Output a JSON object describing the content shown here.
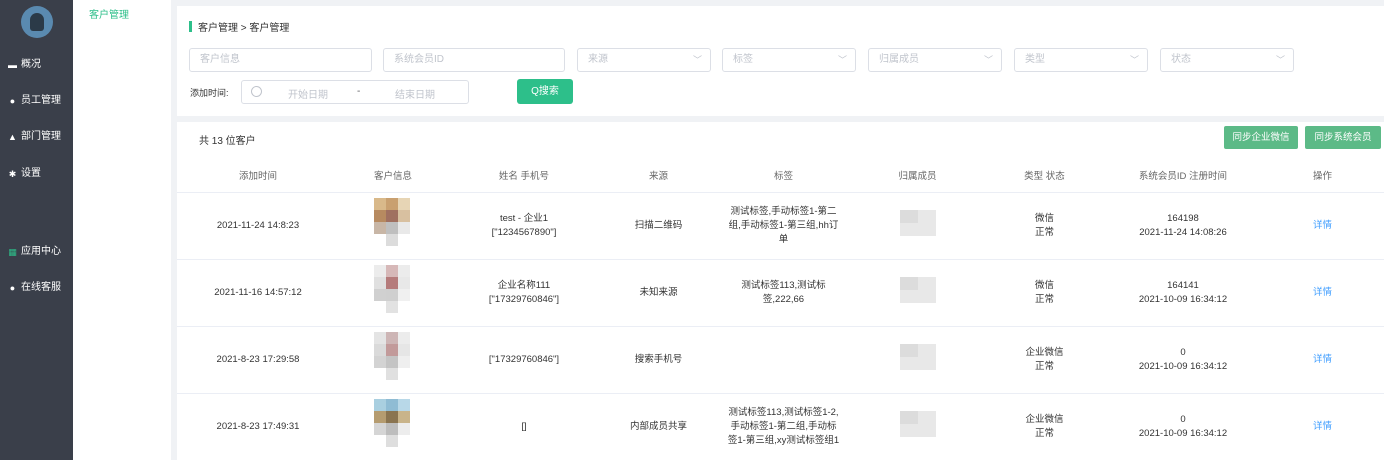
{
  "sidebar": {
    "items": [
      {
        "label": "概况",
        "icon": "overview-icon"
      },
      {
        "label": "员工管理",
        "icon": "staff-icon"
      },
      {
        "label": "部门管理",
        "icon": "department-icon"
      },
      {
        "label": "设置",
        "icon": "gear-icon"
      },
      {
        "label": "应用中心",
        "icon": "grid-icon"
      },
      {
        "label": "在线客服",
        "icon": "support-icon"
      }
    ]
  },
  "submenu": {
    "active": "客户管理"
  },
  "breadcrumb": "客户管理 > 客户管理",
  "filters": {
    "customer_info": "客户信息",
    "member_id": "系统会员ID",
    "source": "来源",
    "tag": "标签",
    "owner": "归属成员",
    "type": "类型",
    "status": "状态",
    "date_label": "添加时间:",
    "date_start": "开始日期",
    "date_sep": "-",
    "date_end": "结束日期",
    "search_label": "Q搜索"
  },
  "table_header": {
    "count": "共 13 位客户",
    "sync_wechat": "同步企业微信",
    "sync_members": "同步系统会员"
  },
  "columns": [
    "添加时间",
    "客户信息",
    "姓名 手机号",
    "来源",
    "标签",
    "归属成员",
    "类型 状态",
    "系统会员ID 注册时间",
    "操作"
  ],
  "rows": [
    {
      "added": "2021-11-24 14:8:23",
      "name": "test - 企业1",
      "phone": "[\"1234567890\"]",
      "source": "扫描二维码",
      "tags": "测试标签,手动标签1-第二组,手动标签1-第三组,hh订单",
      "type": "微信",
      "status": "正常",
      "member_id": "164198",
      "reg_time": "2021-11-24 14:08:26",
      "action": "详情"
    },
    {
      "added": "2021-11-16 14:57:12",
      "name": "企业名称111",
      "phone": "[\"17329760846\"]",
      "source": "未知来源",
      "tags": "测试标签113,测试标签,222,66",
      "type": "微信",
      "status": "正常",
      "member_id": "164141",
      "reg_time": "2021-10-09 16:34:12",
      "action": "详情"
    },
    {
      "added": "2021-8-23 17:29:58",
      "name": "",
      "phone": "[\"17329760846\"]",
      "source": "搜索手机号",
      "tags": "",
      "type": "企业微信",
      "status": "正常",
      "member_id": "0",
      "reg_time": "2021-10-09 16:34:12",
      "action": "详情"
    },
    {
      "added": "2021-8-23 17:49:31",
      "name": "",
      "phone": "[]",
      "source": "内部成员共享",
      "tags": "测试标签113,测试标签1-2,手动标签1-第二组,手动标签1-第三组,xy测试标签组1",
      "type": "企业微信",
      "status": "正常",
      "member_id": "0",
      "reg_time": "2021-10-09 16:34:12",
      "action": "详情"
    }
  ],
  "colors": {
    "accent": "#2dbf8a",
    "sidebar": "#3a3f4a",
    "link": "#409eff"
  }
}
